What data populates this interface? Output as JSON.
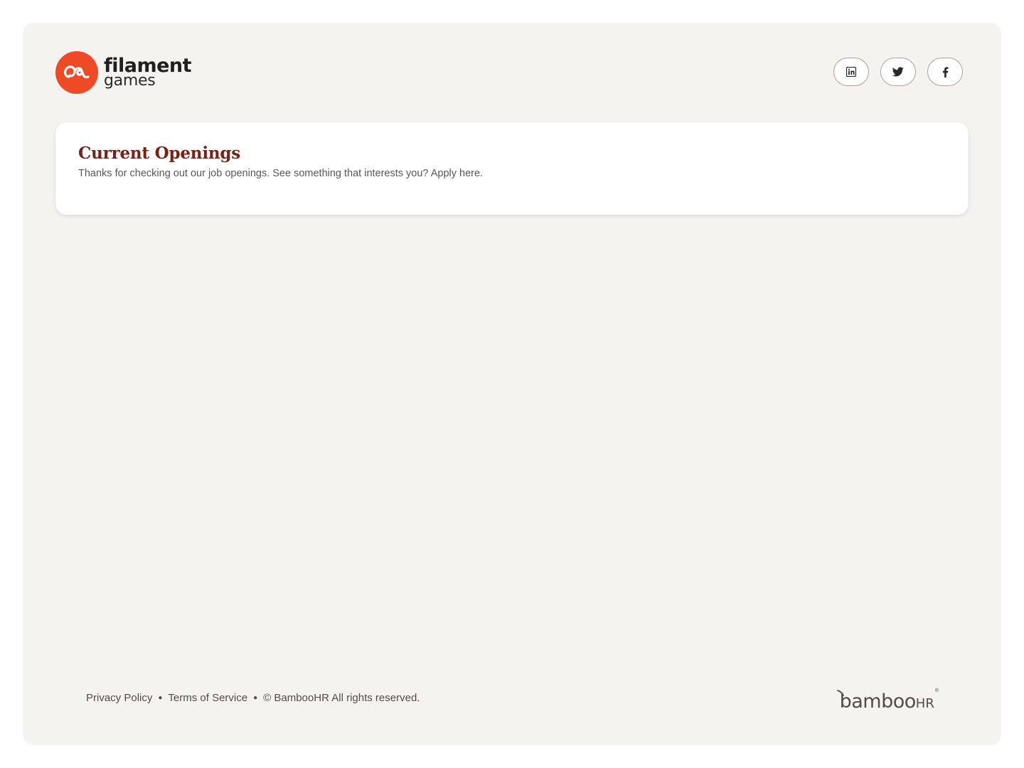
{
  "brand": {
    "logo_line1": "filament",
    "logo_line2": "games",
    "accent_color": "#ef4a26"
  },
  "social": [
    {
      "name": "linkedin-icon"
    },
    {
      "name": "twitter-icon"
    },
    {
      "name": "facebook-icon"
    }
  ],
  "openings": {
    "title": "Current Openings",
    "description": "Thanks for checking out our job openings. See something that interests you? Apply here."
  },
  "footer": {
    "privacy": "Privacy Policy",
    "terms": "Terms of Service",
    "copyright": "© BambooHR All rights reserved.",
    "powered_by_main": "bamboo",
    "powered_by_suffix": "HR"
  }
}
